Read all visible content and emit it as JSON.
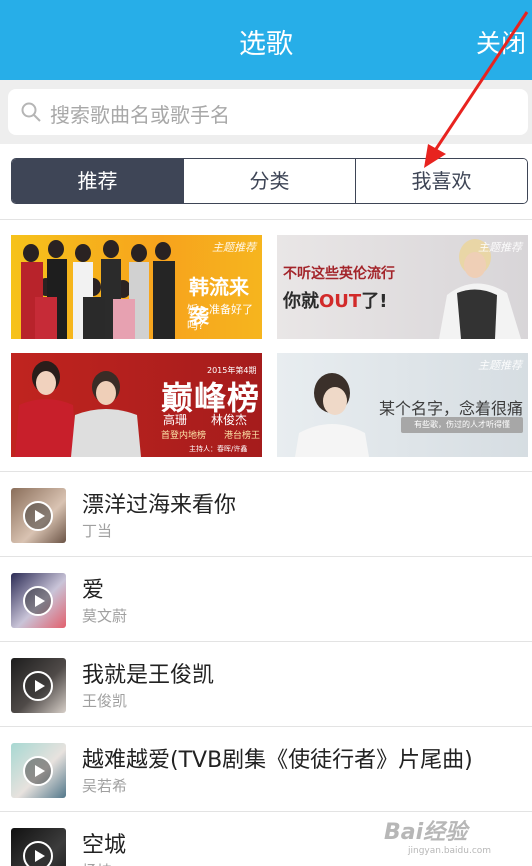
{
  "header": {
    "title": "选歌",
    "close_label": "关闭"
  },
  "search": {
    "placeholder": "搜索歌曲名或歌手名"
  },
  "tabs": [
    {
      "label": "推荐",
      "active": true
    },
    {
      "label": "分类",
      "active": false
    },
    {
      "label": "我喜欢",
      "active": false
    }
  ],
  "banners": [
    {
      "tag": "主题推荐",
      "title": "韩流来袭",
      "subtitle": "饭，准备好了吗?"
    },
    {
      "tag": "主题推荐",
      "line1": "不听这些英伦流行",
      "line2a": "你就",
      "line2b": "OUT",
      "line2c": "了!"
    },
    {
      "title": "巅峰榜",
      "year": "2015年第4期",
      "names": "高珊　　林俊杰",
      "subnames": "首登内地榜　　港台榜王",
      "host": "主持人：春晖/许鑫"
    },
    {
      "tag": "主题推荐",
      "quote": "某个名字，念着很痛",
      "note": "有些歌，伤过的人才听得懂"
    }
  ],
  "songs": [
    {
      "name": "漂洋过海来看你",
      "artist": "丁当"
    },
    {
      "name": "爱",
      "artist": "莫文蔚"
    },
    {
      "name": "我就是王俊凯",
      "artist": "王俊凯"
    },
    {
      "name": "越难越爱(TVB剧集《使徒行者》片尾曲)",
      "artist": "吴若希"
    },
    {
      "name": "空城",
      "artist": "杨坤"
    }
  ],
  "watermark": {
    "logo": "Bai经验",
    "url": "jingyan.baidu.com"
  },
  "colors": {
    "header": "#27aee8",
    "tab_active": "#3e4556",
    "annotation_arrow": "#e8231f"
  }
}
